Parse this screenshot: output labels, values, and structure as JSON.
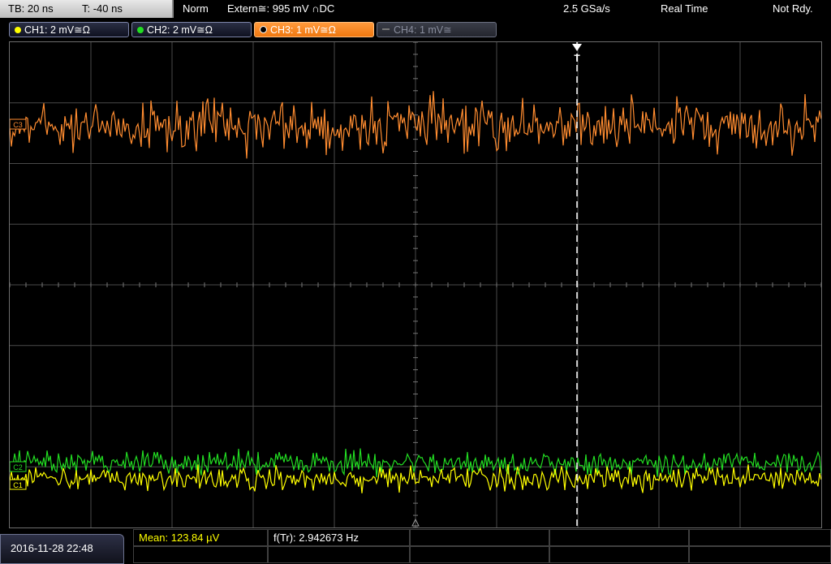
{
  "timebase": {
    "tb": "TB: 20 ns",
    "trig_offset": "T: -40 ns"
  },
  "status": {
    "mode": "Norm",
    "trigger": "Extern≅: 995 mV ∩DC",
    "sample_rate": "2.5 GSa/s",
    "acq_mode": "Real Time",
    "ready": "Not Rdy."
  },
  "channels": [
    {
      "label": "CH1: 2 mV≅Ω",
      "color": "#ffff00",
      "state": "on"
    },
    {
      "label": "CH2: 2 mV≅Ω",
      "color": "#22dd22",
      "state": "on"
    },
    {
      "label": "CH3: 1 mV≅Ω",
      "color": "#ff8c30",
      "state": "active"
    },
    {
      "label": "CH4: 1 mV≅",
      "color": "#888888",
      "state": "off"
    }
  ],
  "markers": {
    "trigger": "T",
    "ch3": "C3",
    "ch2": "C2",
    "ch1": "C1"
  },
  "footer": {
    "date": "2016-11-28 22:48",
    "mean": "Mean: 123.84 µV",
    "freq": "f(Tr): 2.942673 Hz"
  },
  "colors": {
    "ch1": "#ffff00",
    "ch2": "#22dd22",
    "ch3": "#ff8c30",
    "grid": "#4a4a4a"
  }
}
